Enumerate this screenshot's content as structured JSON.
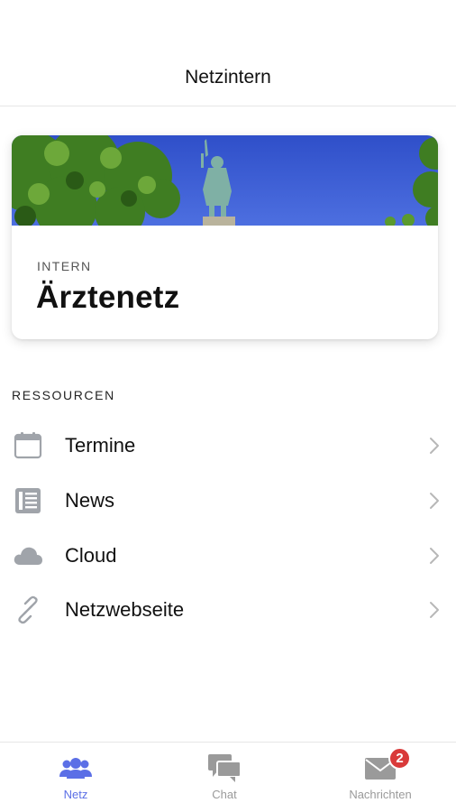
{
  "header": {
    "title": "Netzintern"
  },
  "card": {
    "eyebrow": "INTERN",
    "title": "Ärztenetz"
  },
  "resources": {
    "section_title": "RESSOURCEN",
    "items": [
      {
        "label": "Termine",
        "icon": "calendar-icon"
      },
      {
        "label": "News",
        "icon": "newspaper-icon"
      },
      {
        "label": "Cloud",
        "icon": "cloud-icon"
      },
      {
        "label": "Netzwebseite",
        "icon": "link-icon"
      }
    ]
  },
  "tabs": [
    {
      "label": "Netz",
      "icon": "people-icon",
      "active": true
    },
    {
      "label": "Chat",
      "icon": "chat-icon",
      "active": false
    },
    {
      "label": "Nachrichten",
      "icon": "envelope-icon",
      "active": false,
      "badge": "2"
    }
  ],
  "colors": {
    "accent": "#5b6fe6",
    "inactive": "#9a9a9a",
    "icon_gray": "#a0a4aa",
    "badge": "#d93a3a"
  }
}
